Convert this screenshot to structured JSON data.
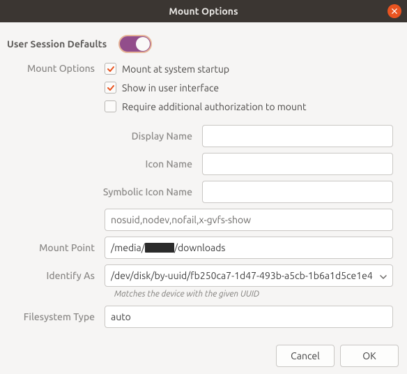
{
  "window": {
    "title": "Mount Options"
  },
  "section_title": "User Session Defaults",
  "toggle_on": true,
  "labels": {
    "mount_options": "Mount Options",
    "display_name": "Display Name",
    "icon_name": "Icon Name",
    "symbolic_icon_name": "Symbolic Icon Name",
    "mount_point": "Mount Point",
    "identify_as": "Identify As",
    "filesystem_type": "Filesystem Type"
  },
  "checkboxes": {
    "startup": {
      "label": "Mount at system startup",
      "checked": true
    },
    "show_ui": {
      "label": "Show in user interface",
      "checked": true
    },
    "require_auth": {
      "label": "Require additional authorization to mount",
      "checked": false
    }
  },
  "fields": {
    "display_name": "",
    "icon_name": "",
    "symbolic_icon_name": "",
    "options_line": "nosuid,nodev,nofail,x-gvfs-show",
    "mount_point_prefix": "/media/",
    "mount_point_suffix": "/downloads",
    "identify_as": "/dev/disk/by-uuid/fb250ca7-1d47-493b-a5cb-1b6a1d5ce1e4",
    "identify_hint": "Matches the device with the given UUID",
    "filesystem_type": "auto"
  },
  "buttons": {
    "cancel": "Cancel",
    "ok": "OK"
  }
}
